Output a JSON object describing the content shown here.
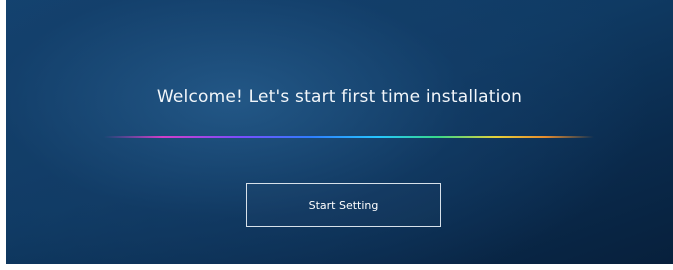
{
  "welcome": {
    "message": "Welcome! Let's start first time installation"
  },
  "actions": {
    "start_label": "Start Setting"
  },
  "colors": {
    "background_light": "#134472",
    "background_dark": "#07203c",
    "text": "#f2f6fa",
    "button_border": "#d7e1ea",
    "divider_gradient": [
      "#e63cd2",
      "#7a4dff",
      "#2f7dff",
      "#26c6ff",
      "#37d98a",
      "#e6d13a",
      "#ff9628"
    ]
  }
}
